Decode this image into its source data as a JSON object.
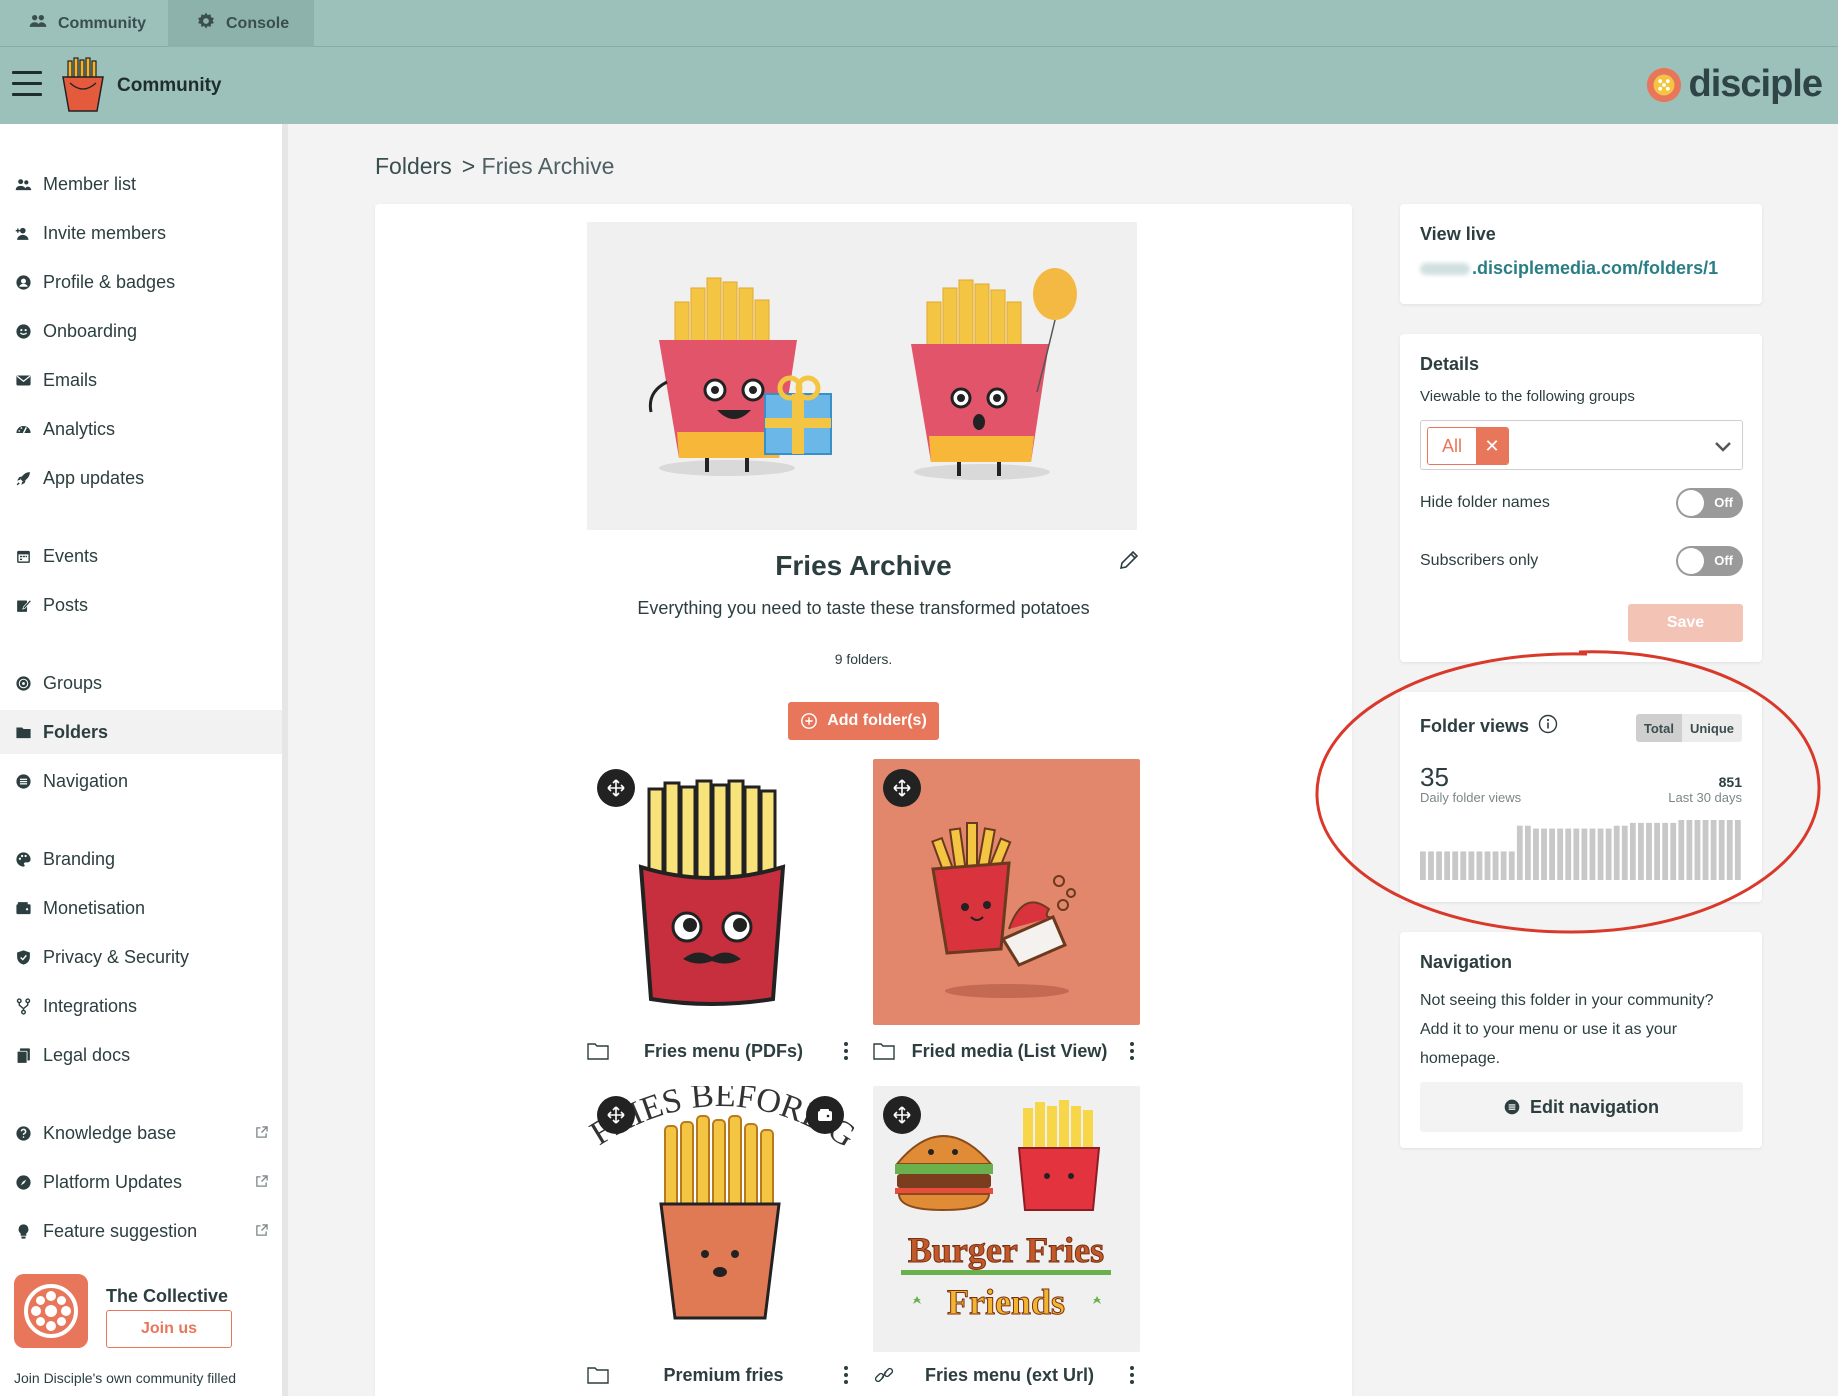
{
  "top_tabs": [
    {
      "label": "Community",
      "icon": "people-icon"
    },
    {
      "label": "Console",
      "icon": "gear-icon"
    }
  ],
  "app": {
    "name": "Community",
    "brand": "disciple"
  },
  "sidebar": {
    "items": [
      {
        "label": "Member list",
        "icon": "members-icon"
      },
      {
        "label": "Invite members",
        "icon": "add-person-icon"
      },
      {
        "label": "Profile & badges",
        "icon": "profile-icon"
      },
      {
        "label": "Onboarding",
        "icon": "smile-icon"
      },
      {
        "label": "Emails",
        "icon": "mail-icon"
      },
      {
        "label": "Analytics",
        "icon": "gauge-icon"
      },
      {
        "label": "App updates",
        "icon": "rocket-icon"
      },
      {
        "label": "Events",
        "icon": "calendar-icon"
      },
      {
        "label": "Posts",
        "icon": "edit-icon"
      },
      {
        "label": "Groups",
        "icon": "globe-icon"
      },
      {
        "label": "Folders",
        "icon": "folder-icon"
      },
      {
        "label": "Navigation",
        "icon": "list-icon"
      },
      {
        "label": "Branding",
        "icon": "palette-icon"
      },
      {
        "label": "Monetisation",
        "icon": "wallet-icon"
      },
      {
        "label": "Privacy & Security",
        "icon": "shield-icon"
      },
      {
        "label": "Integrations",
        "icon": "fork-icon"
      },
      {
        "label": "Legal docs",
        "icon": "docs-icon"
      },
      {
        "label": "Knowledge base",
        "icon": "question-icon"
      },
      {
        "label": "Platform Updates",
        "icon": "compass-icon"
      },
      {
        "label": "Feature suggestion",
        "icon": "bulb-icon"
      }
    ],
    "active": "Folders",
    "collective": {
      "name": "The Collective",
      "join_label": "Join us",
      "description": "Join Disciple's own community filled"
    }
  },
  "breadcrumb": {
    "root": "Folders",
    "separator": ">",
    "current": "Fries Archive"
  },
  "folder": {
    "title": "Fries Archive",
    "description": "Everything you need to taste these transformed potatoes",
    "count": "9 folders.",
    "add_label": "Add folder(s)",
    "tiles": [
      {
        "name": "Fries menu (PDFs)",
        "type_icon": "folder-icon"
      },
      {
        "name": "Fried media (List View)",
        "type_icon": "folder-icon"
      },
      {
        "name": "Premium fries",
        "type_icon": "folder-icon",
        "art_text": "FRIES BEFORE GUYS"
      },
      {
        "name": "Fries menu (ext Url)",
        "type_icon": "link-icon",
        "art_text_1": "Burger Fries",
        "art_text_2": "Friends"
      }
    ]
  },
  "view_live": {
    "title": "View live",
    "url": ".disciplemedia.com/folders/1"
  },
  "details": {
    "title": "Details",
    "groups_label": "Viewable to the following groups",
    "selected_group": "All",
    "hide_names_label": "Hide folder names",
    "hide_names_value": "Off",
    "subscribers_label": "Subscribers only",
    "subscribers_value": "Off",
    "save_label": "Save"
  },
  "folder_views": {
    "title": "Folder views",
    "seg_total": "Total",
    "seg_unique": "Unique",
    "daily_value": "35",
    "daily_label": "Daily folder views",
    "last30_value": "851",
    "last30_label": "Last 30 days",
    "bars": [
      20,
      20,
      20,
      20,
      20,
      20,
      20,
      20,
      20,
      20,
      20,
      20,
      38,
      38,
      36,
      36,
      36,
      36,
      36,
      36,
      36,
      36,
      36,
      36,
      38,
      38,
      40,
      40,
      40,
      40,
      40,
      40,
      42,
      42,
      42,
      42,
      42,
      42,
      42,
      42
    ]
  },
  "navigation_card": {
    "title": "Navigation",
    "description": "Not seeing this folder in your community? Add it to your menu or use it as your homepage.",
    "button_label": "Edit navigation"
  },
  "colors": {
    "accent": "#e8765b",
    "header": "#9cc0ba",
    "link": "#2a7e86",
    "annotation": "#d9392a"
  }
}
